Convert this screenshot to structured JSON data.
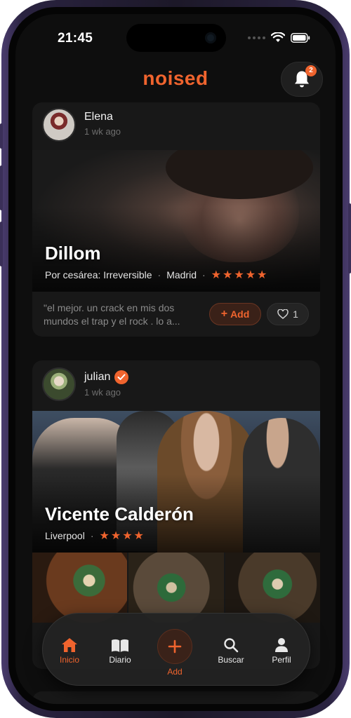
{
  "status_bar": {
    "time": "21:45"
  },
  "header": {
    "logo": "noised",
    "notifications_count": "2"
  },
  "posts": [
    {
      "user": "Elena",
      "time": "1 wk ago",
      "title": "Dillom",
      "album": "Por cesárea: Irreversible",
      "city": "Madrid",
      "stars": "★★★★★",
      "review": "\"el mejor. un crack en mis dos mundos el trap y el rock . lo a...",
      "add_label": "Add",
      "likes": "1"
    },
    {
      "user": "julian",
      "verified": true,
      "time": "1 wk ago",
      "title": "Vicente Calderón",
      "city": "Liverpool",
      "stars": "★★★★"
    }
  ],
  "tabbar": {
    "items": [
      {
        "label": "Inicio",
        "icon": "home-icon",
        "active": true
      },
      {
        "label": "Diario",
        "icon": "book-icon"
      },
      {
        "label": "Add",
        "icon": "plus-icon"
      },
      {
        "label": "Buscar",
        "icon": "search-icon"
      },
      {
        "label": "Perfil",
        "icon": "person-icon"
      }
    ]
  },
  "colors": {
    "accent": "#f0642e",
    "background": "#0e0e0e",
    "card": "#181818"
  }
}
